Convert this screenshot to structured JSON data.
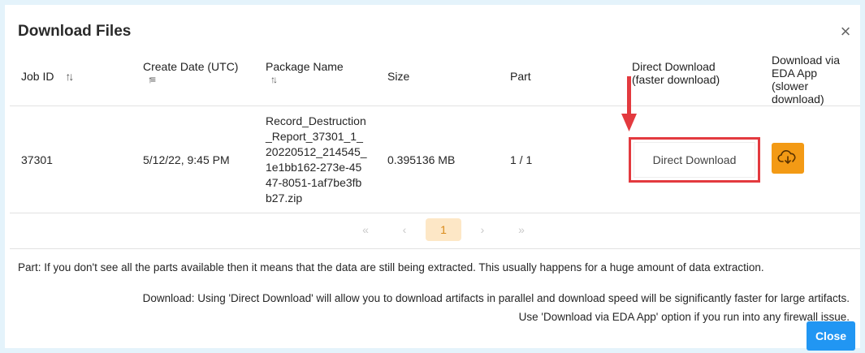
{
  "dialog": {
    "title": "Download Files",
    "close_glyph": "×"
  },
  "table": {
    "headers": {
      "job_id": "Job ID",
      "create_date": "Create Date (UTC)",
      "package_name": "Package Name",
      "size": "Size",
      "part": "Part",
      "direct_download": "Direct Download (faster download)",
      "eda_download": "Download via EDA App (slower download)"
    },
    "rows": [
      {
        "job_id": "37301",
        "create_date": "5/12/22, 9:45 PM",
        "package_name": "Record_Destruction_Report_37301_1_20220512_214545_1e1bb162-273e-4547-8051-1af7be3fbb27.zip",
        "size": "0.395136 MB",
        "part": "1 / 1",
        "direct_download_label": "Direct Download"
      }
    ]
  },
  "pagination": {
    "first": "«",
    "prev": "‹",
    "current": "1",
    "next": "›",
    "last": "»"
  },
  "notes": {
    "part": "Part: If you don't see all the parts available then it means that the data are still being extracted. This usually happens for a huge amount of data extraction.",
    "download_line1": "Download: Using 'Direct Download' will allow you to download artifacts in parallel and download speed will be significantly faster for large artifacts.",
    "download_line2": "Use 'Download via EDA App' option if you run into any firewall issue."
  },
  "footer": {
    "close_label": "Close"
  },
  "colors": {
    "accent_blue": "#2196f3",
    "eda_orange": "#f39a15",
    "highlight_red": "#e33a3f",
    "page_active_bg": "#fde7c6"
  },
  "icons": {
    "sort": "sort-arrows-icon",
    "sort_asc": "sort-ascending-icon",
    "cloud": "cloud-download-icon",
    "annotation": "red-arrow-icon"
  }
}
